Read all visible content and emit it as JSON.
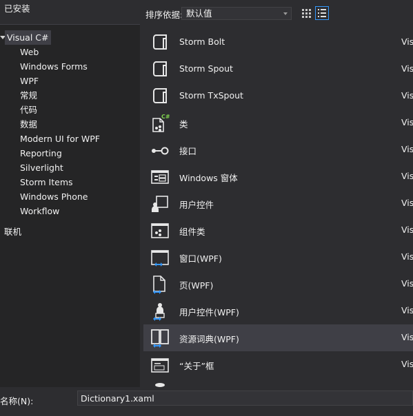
{
  "left_panel": {
    "header": "已安装",
    "root": "Visual C#",
    "children": [
      "Web",
      "Windows Forms",
      "WPF",
      "常规",
      "代码",
      "数据",
      "Modern UI for WPF",
      "Reporting",
      "Silverlight",
      "Storm Items",
      "Windows Phone",
      "Workflow"
    ],
    "online": "联机"
  },
  "toolbar": {
    "sort_label": "排序依据:",
    "sort_value": "默认值"
  },
  "items": [
    {
      "name": "Storm Bolt",
      "lang": "Vis",
      "icon": "storm-bolt-icon"
    },
    {
      "name": "Storm Spout",
      "lang": "Vis",
      "icon": "storm-spout-icon"
    },
    {
      "name": "Storm TxSpout",
      "lang": "Vis",
      "icon": "storm-txspout-icon"
    },
    {
      "name": "类",
      "lang": "Vis",
      "icon": "class-icon"
    },
    {
      "name": "接口",
      "lang": "Vis",
      "icon": "interface-icon"
    },
    {
      "name": "Windows 窗体",
      "lang": "Vis",
      "icon": "windows-form-icon"
    },
    {
      "name": "用户控件",
      "lang": "Vis",
      "icon": "user-control-icon"
    },
    {
      "name": "组件类",
      "lang": "Vis",
      "icon": "component-class-icon"
    },
    {
      "name": "窗口(WPF)",
      "lang": "Vis",
      "icon": "wpf-window-icon"
    },
    {
      "name": "页(WPF)",
      "lang": "Vis",
      "icon": "wpf-page-icon"
    },
    {
      "name": "用户控件(WPF)",
      "lang": "Vis",
      "icon": "wpf-user-control-icon"
    },
    {
      "name": "资源词典(WPF)",
      "lang": "Vis",
      "icon": "resource-dictionary-icon",
      "selected": true
    },
    {
      "name": "“关于”框",
      "lang": "Vis",
      "icon": "about-box-icon"
    }
  ],
  "bottom": {
    "name_label": "名称(N):",
    "name_value": "Dictionary1.xaml"
  },
  "colors": {
    "background": "#2d2d30",
    "panel": "#252526",
    "selection": "#3f3f46",
    "accent": "#3399ff",
    "csharp_badge": "#7fd34e"
  }
}
